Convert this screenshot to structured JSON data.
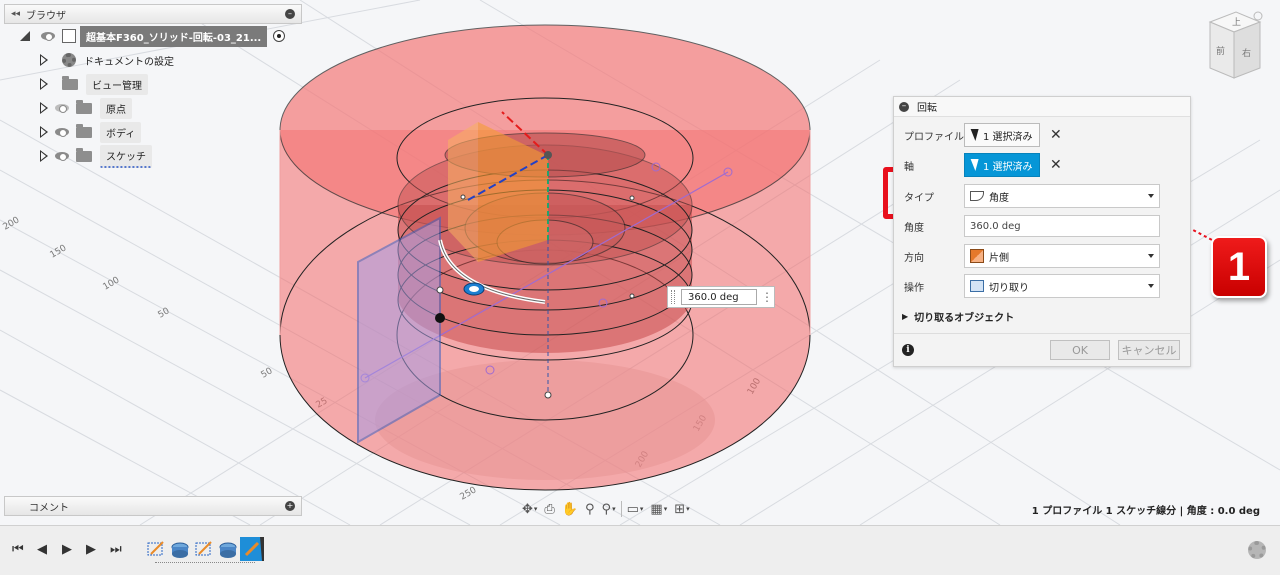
{
  "browser": {
    "title": "ブラウザ",
    "root_label": "超基本F360_ソリッド-回転-03_21...",
    "items": [
      {
        "label": "ドキュメントの設定",
        "icon": "gear-icon"
      },
      {
        "label": "ビュー管理",
        "icon": "folder-icon"
      },
      {
        "label": "原点",
        "icon": "folder-icon"
      },
      {
        "label": "ボディ",
        "icon": "folder-icon"
      },
      {
        "label": "スケッチ",
        "icon": "folder-icon"
      }
    ]
  },
  "comment": {
    "title": "コメント"
  },
  "dialog": {
    "title": "回転",
    "profile_label": "プロファイル",
    "profile_value": "1 選択済み",
    "axis_label": "軸",
    "axis_value": "1 選択済み",
    "type_label": "タイプ",
    "type_value": "角度",
    "angle_label": "角度",
    "angle_value": "360.0 deg",
    "direction_label": "方向",
    "direction_value": "片側",
    "operation_label": "操作",
    "operation_value": "切り取り",
    "cut_objects_label": "切り取るオブジェクト",
    "ok_label": "OK",
    "cancel_label": "キャンセル"
  },
  "callout": {
    "number": "1",
    "color": "#e8101d"
  },
  "viewport": {
    "angle_tag": "360.0 deg",
    "axis_ticks": [
      "200",
      "150",
      "100",
      "50",
      "50",
      "25",
      "250",
      "200",
      "150",
      "100"
    ],
    "viewcube_faces": [
      "上",
      "前",
      "右"
    ]
  },
  "status": {
    "text": "1 プロファイル 1 スケッチ線分 | 角度 : 0.0 deg"
  },
  "accent_color": "#0696d7",
  "body_color": "#f06a6a"
}
